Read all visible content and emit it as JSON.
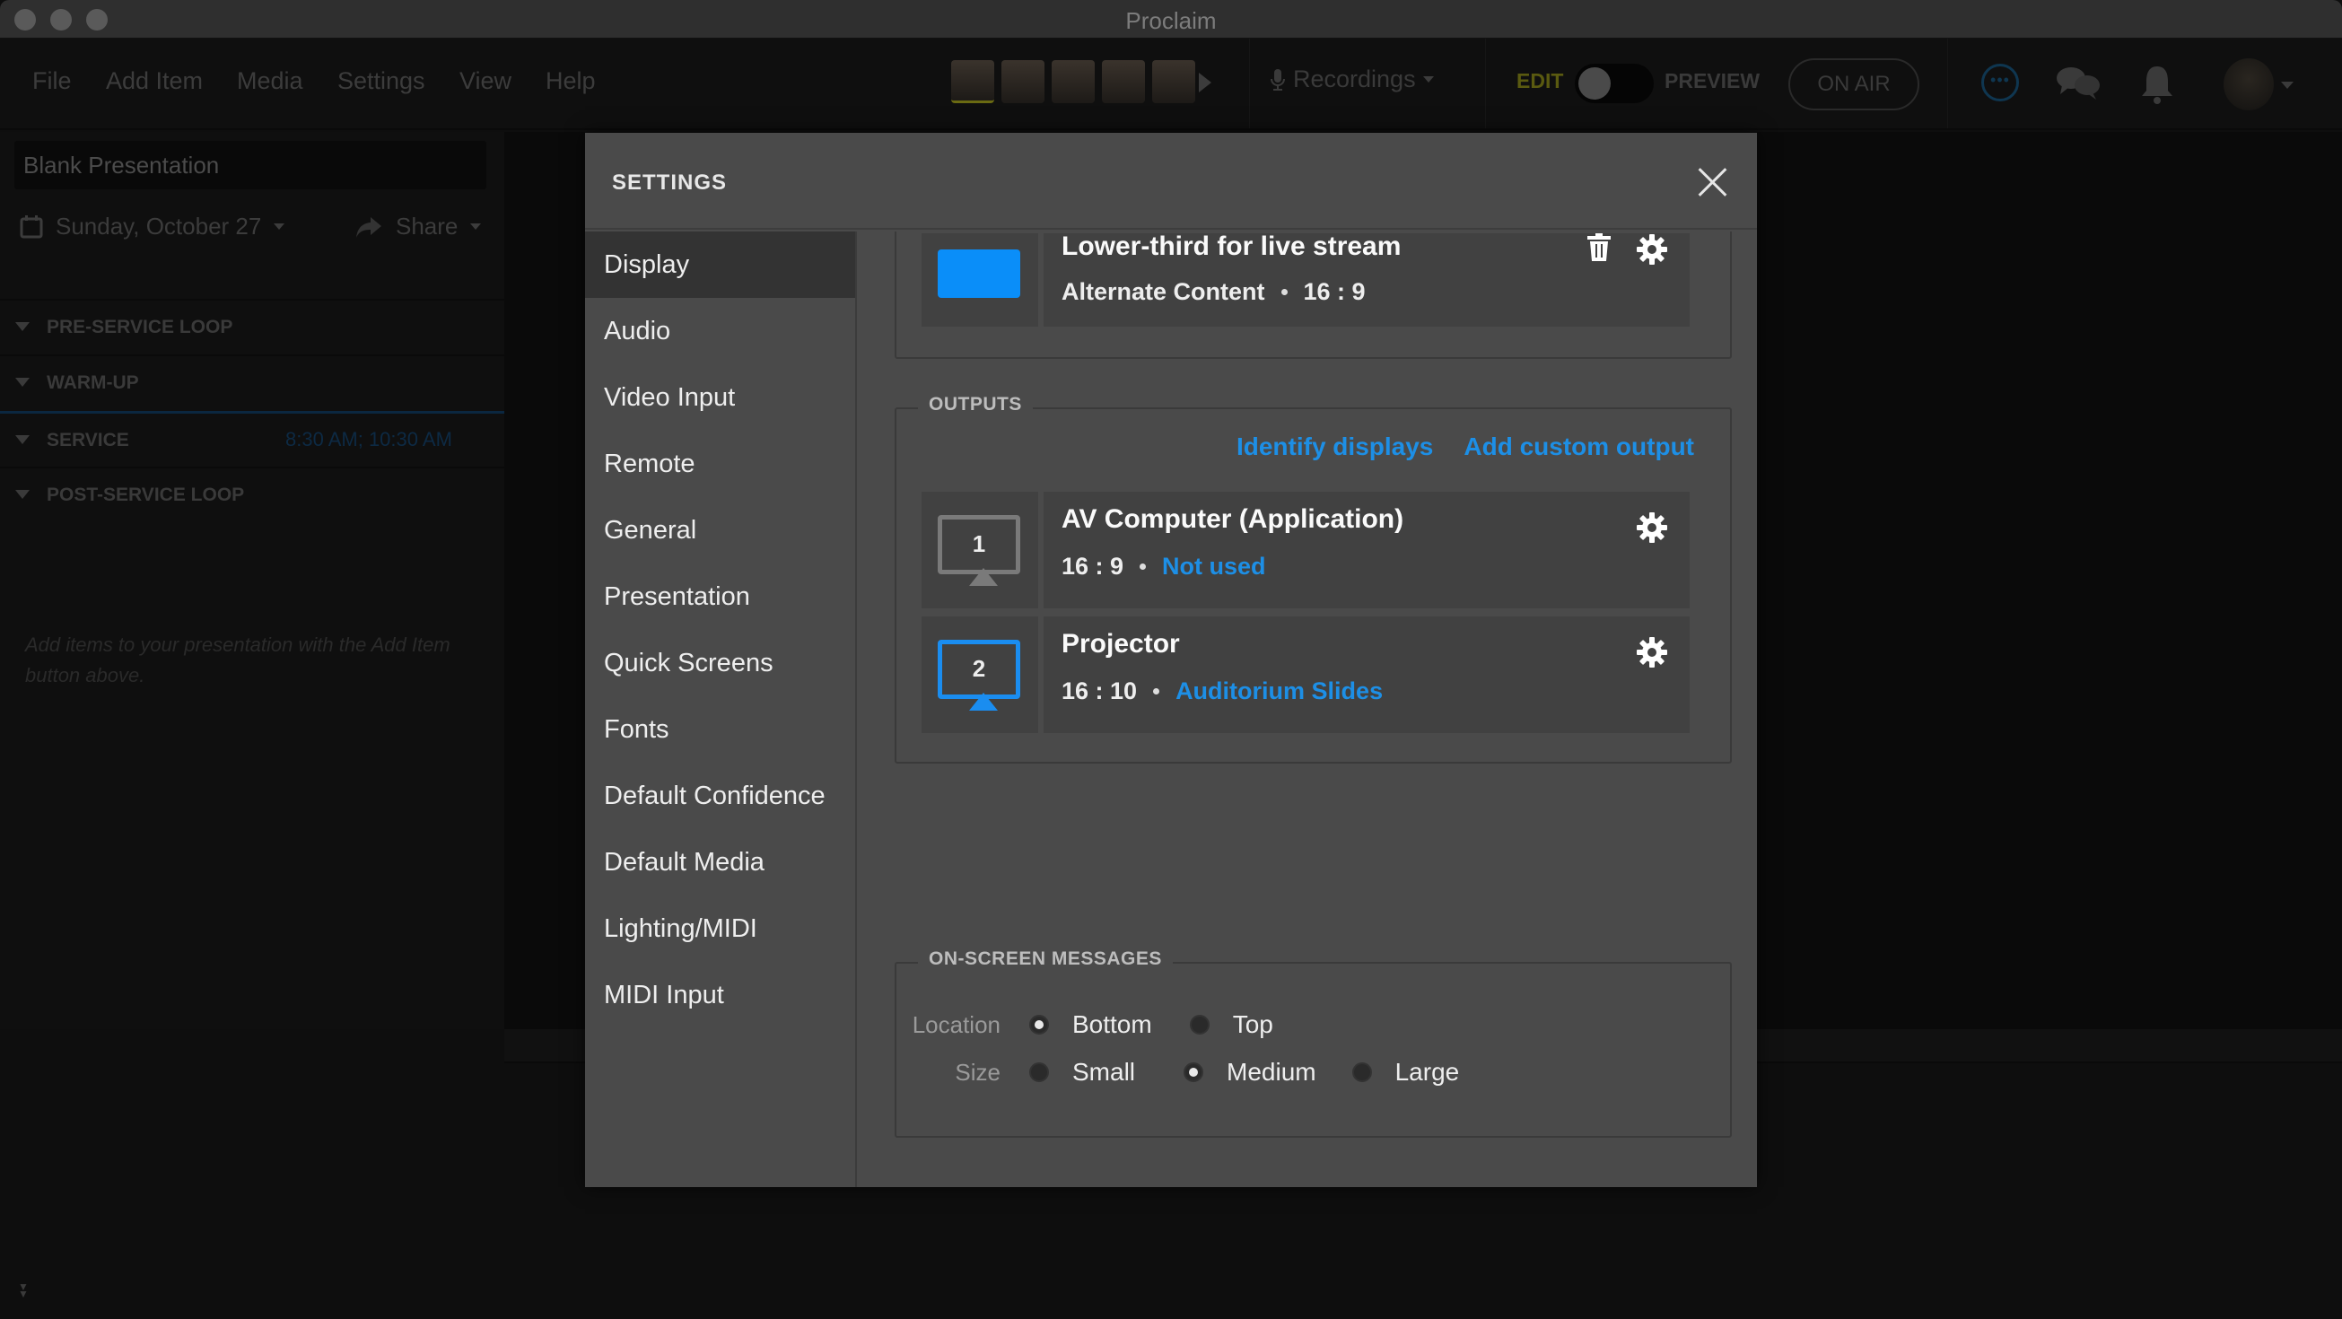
{
  "window": {
    "title": "Proclaim"
  },
  "menu": {
    "items": [
      "File",
      "Add Item",
      "Media",
      "Settings",
      "View",
      "Help"
    ]
  },
  "toolbar": {
    "recordings_label": "Recordings",
    "edit_label": "EDIT",
    "preview_label": "PREVIEW",
    "on_air_label": "ON AIR",
    "more_icon_text": "•••"
  },
  "left_panel": {
    "presentation_title": "Blank Presentation",
    "date": "Sunday, October 27",
    "share_label": "Share",
    "sections": [
      {
        "label": "PRE-SERVICE LOOP",
        "times": ""
      },
      {
        "label": "WARM-UP",
        "times": ""
      },
      {
        "label": "SERVICE",
        "times": "8:30 AM; 10:30 AM"
      },
      {
        "label": "POST-SERVICE LOOP",
        "times": ""
      }
    ],
    "empty_hint": "Add items to your presentation with the Add Item button above."
  },
  "settings": {
    "title": "SETTINGS",
    "nav": [
      {
        "label": "Display",
        "active": true
      },
      {
        "label": "Audio"
      },
      {
        "label": "Video Input"
      },
      {
        "label": "Remote"
      },
      {
        "label": "General"
      },
      {
        "label": "Presentation"
      },
      {
        "label": "Quick Screens"
      },
      {
        "label": "Fonts"
      },
      {
        "label": "Default Confidence"
      },
      {
        "label": "Default Media"
      },
      {
        "label": "Lighting/MIDI"
      },
      {
        "label": "MIDI Input"
      }
    ],
    "lower_third": {
      "name": "Lower-third for live stream",
      "type": "Alternate Content",
      "aspect": "16 : 9",
      "swatch_color": "#0a8ef9"
    },
    "outputs": {
      "legend": "OUTPUTS",
      "identify_label": "Identify displays",
      "add_custom_label": "Add custom output",
      "items": [
        {
          "number": "1",
          "name": "AV Computer (Application)",
          "aspect": "16 : 9",
          "status": "Not used",
          "active": false
        },
        {
          "number": "2",
          "name": "Projector",
          "aspect": "16 : 10",
          "status": "Auditorium Slides",
          "active": true
        }
      ]
    },
    "messages": {
      "legend": "ON-SCREEN MESSAGES",
      "location_label": "Location",
      "location_options": [
        "Bottom",
        "Top"
      ],
      "location_selected": "Bottom",
      "size_label": "Size",
      "size_options": [
        "Small",
        "Medium",
        "Large"
      ],
      "size_selected": "Medium"
    }
  },
  "colors": {
    "accent": "#1d8fe6",
    "edit_label": "#5a5a10"
  }
}
